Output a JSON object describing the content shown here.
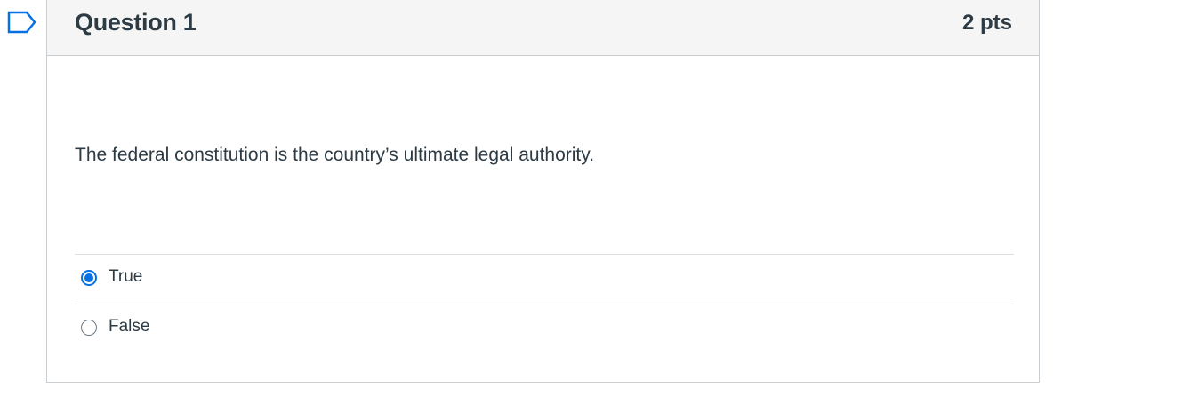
{
  "question": {
    "title": "Question 1",
    "points": "2 pts",
    "text": "The federal constitution is the country’s ultimate legal authority.",
    "answers": [
      {
        "label": "True",
        "selected": true
      },
      {
        "label": "False",
        "selected": false
      }
    ]
  },
  "colors": {
    "accent": "#0770e3",
    "flag": "#0770e3",
    "header_bg": "#f5f5f5",
    "border": "#c7cdd1",
    "text": "#2d3b45"
  },
  "icons": {
    "flag": "flag-question-icon"
  }
}
